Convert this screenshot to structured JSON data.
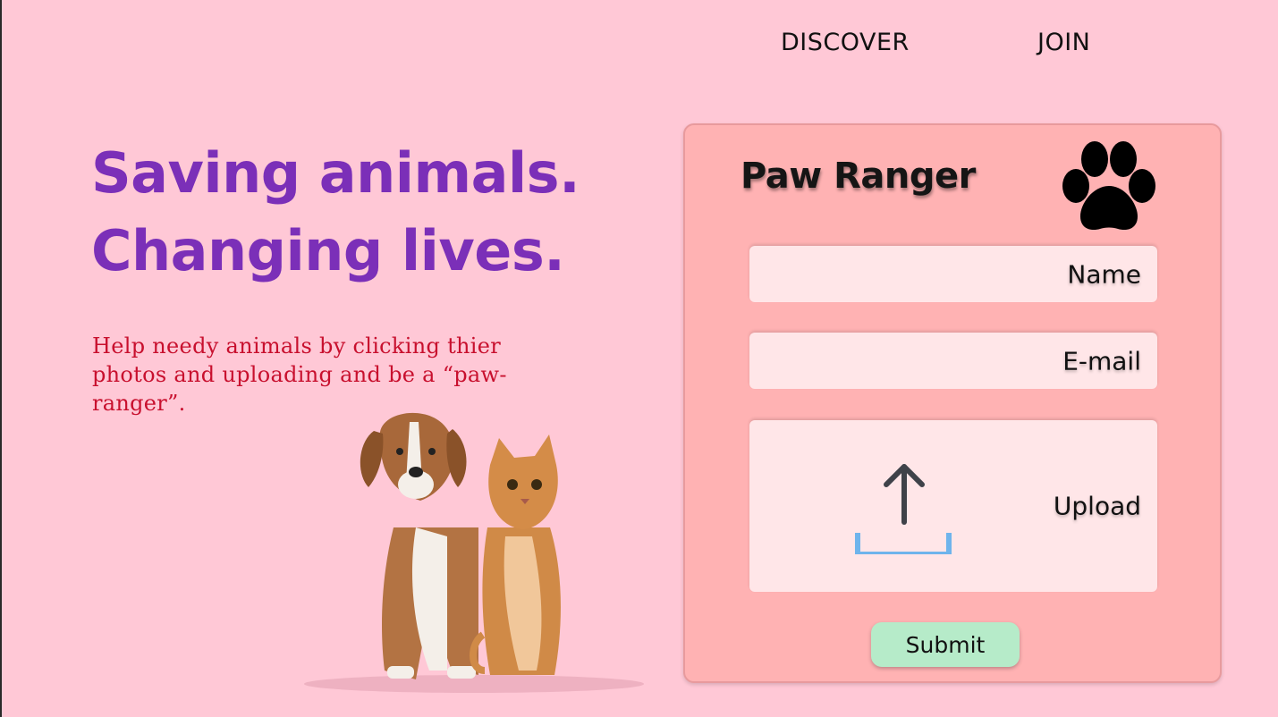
{
  "nav": {
    "discover": "DISCOVER",
    "join": "JOIN"
  },
  "hero": {
    "title_line1": "Saving animals.",
    "title_line2": "Changing lives.",
    "subtitle": "Help needy animals by clicking thier photos and uploading and be a “paw-ranger”."
  },
  "form": {
    "brand": "Paw Ranger",
    "paw_icon": "paw-icon",
    "name_label": "Name",
    "email_label": "E-mail",
    "upload_label": "Upload",
    "upload_icon": "upload-icon",
    "submit_label": "Submit"
  },
  "colors": {
    "background": "#ffc8d6",
    "title_purple": "#7b2fb8",
    "subtitle_red": "#c8102e",
    "card": "#ffb2b3",
    "field": "#ffe6e8",
    "submit": "#b6ebc9",
    "upload_tray": "#6fb4ec"
  }
}
